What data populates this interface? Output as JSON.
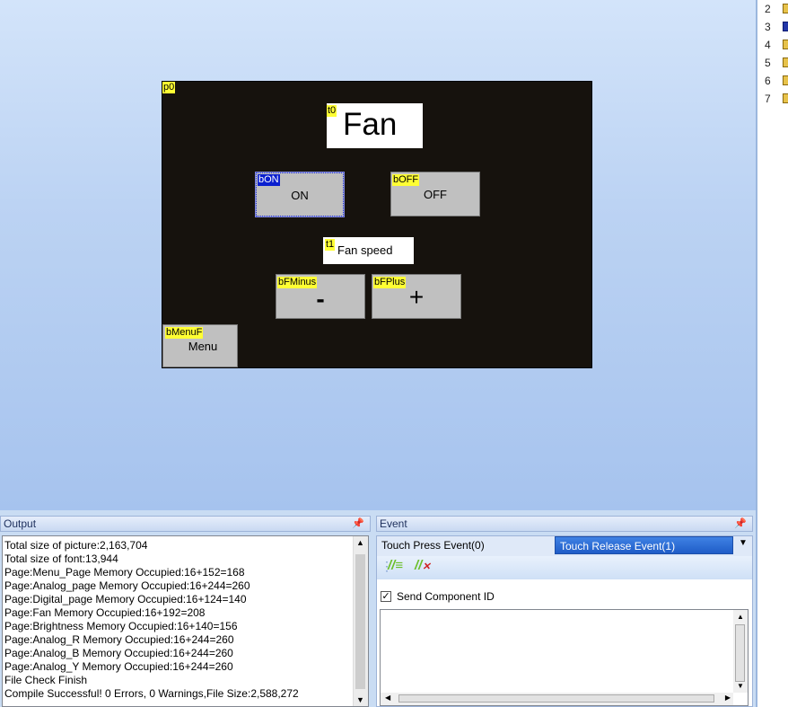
{
  "right_panel": {
    "rows": [
      "2",
      "3",
      "4",
      "5",
      "6",
      "7"
    ]
  },
  "hmi": {
    "page_tag": "p0",
    "t0": {
      "tag": "t0",
      "text": "Fan"
    },
    "bON": {
      "tag": "bON",
      "label": "ON"
    },
    "bOFF": {
      "tag": "bOFF",
      "label": "OFF"
    },
    "t1": {
      "tag": "t1",
      "text": "Fan speed"
    },
    "bFMinus": {
      "tag": "bFMinus",
      "label": "-"
    },
    "bFPlus": {
      "tag": "bFPlus",
      "label": "+"
    },
    "bMenuF": {
      "tag": "bMenuF",
      "label": "Menu"
    }
  },
  "output": {
    "title": "Output",
    "lines": [
      "Total size of picture:2,163,704",
      "Total size of font:13,944",
      "Page:Menu_Page Memory Occupied:16+152=168",
      "Page:Analog_page Memory Occupied:16+244=260",
      "Page:Digital_page Memory Occupied:16+124=140",
      "Page:Fan Memory Occupied:16+192=208",
      "Page:Brightness Memory Occupied:16+140=156",
      "Page:Analog_R Memory Occupied:16+244=260",
      "Page:Analog_B Memory Occupied:16+244=260",
      "Page:Analog_Y Memory Occupied:16+244=260",
      "File Check Finish",
      "Compile Successful! 0 Errors, 0 Warnings,File Size:2,588,272"
    ]
  },
  "event": {
    "title": "Event",
    "tab_press": "Touch Press Event(0)",
    "tab_release": "Touch Release Event(1)",
    "send_component_id": "Send Component ID",
    "send_component_checked": true
  },
  "icons": {
    "pin": "pin-icon",
    "dropdown": "chevron-down-icon",
    "comment": "comment-icon",
    "uncomment": "uncomment-icon"
  }
}
